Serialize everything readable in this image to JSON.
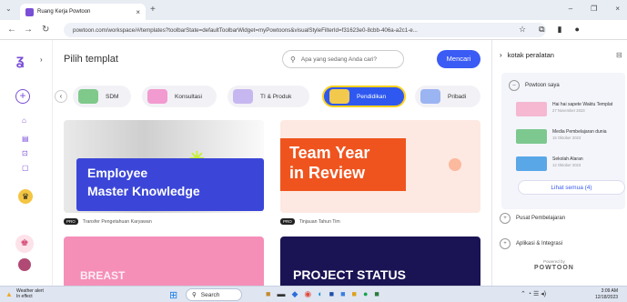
{
  "browser": {
    "tab_title": "Ruang Kerja Powtoon",
    "tab_close": "×",
    "new_tab": "+",
    "url": "powtoon.com/workspace/#/templates?toolbarState=defaultToolbarWidget=myPowtoons&visualStyleFilterId=f31623e0-8cbb-406a-a2c1-e...",
    "window_min": "–",
    "window_close": "×"
  },
  "app": {
    "page_title": "Pilih templat",
    "search_placeholder": "Apa yang sedang Anda cari?",
    "search_button": "Mencari",
    "categories": [
      {
        "label": "SDM",
        "thumb": "#7fc98a"
      },
      {
        "label": "Konsultasi",
        "thumb": "#f29bd0"
      },
      {
        "label": "TI & Produk",
        "thumb": "#c7b7f0"
      },
      {
        "label": "Pendidikan",
        "thumb": "#f2c94c",
        "active": true
      },
      {
        "label": "Pribadi",
        "thumb": "#9bb4f2"
      }
    ],
    "cards": [
      {
        "line1": "Employee",
        "line2": "Master Knowledge",
        "badge": "PRO",
        "caption": "Transfer Pengetahuan Karyawan"
      },
      {
        "line1": "Team Year",
        "line2": "in Review",
        "badge": "PRO",
        "caption": "Tinjauan Tahun Tim"
      },
      {
        "text": "BREAST"
      },
      {
        "text": "PROJECT STATUS"
      }
    ]
  },
  "panel": {
    "title": "kotak peralatan",
    "my_powtoons": "Powtoon saya",
    "items": [
      {
        "title": "Hai hai sapete Waktu Templat",
        "date": "27 November 2023",
        "thumb": "#f5b8d0"
      },
      {
        "title": "Media Pembelajaran dunia",
        "date": "15 Oktober 2023",
        "thumb": "#7dc88f"
      },
      {
        "title": "Sekolah Alaran",
        "date": "12 Oktober 2023",
        "thumb": "#5aa7e8"
      }
    ],
    "see_all": "Lihat semua (4)",
    "learning_center": "Pusat Pembelajaran",
    "apps": "Aplikasi & Integrasi",
    "powered_by": "Powered by",
    "brand": "POWTOON"
  },
  "taskbar": {
    "weather_title": "Weather alert",
    "weather_sub": "In effect",
    "search": "Search",
    "time": "3:09 AM",
    "date": "12/18/2023"
  },
  "colors": {
    "accent": "#2e58f0",
    "brand": "#7a4fd8"
  }
}
